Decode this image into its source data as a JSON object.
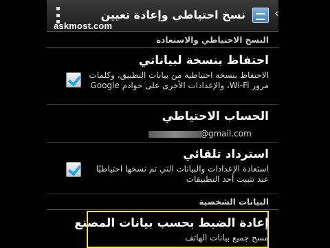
{
  "header": {
    "title": "نسخ احتياطي وإعادة تعيين"
  },
  "watermark": "askmost.com",
  "sections": {
    "backup_restore": "النسخ الاحتياطي والاستعادة",
    "personal_data": "البيانات الشخصية"
  },
  "prefs": {
    "backup_data": {
      "title": "احتفاظ بنسخة لبياناتي",
      "summary": "الاحتفاظ بنسخة احتياطية من بيانات التطبيق، وكلمات مرور Wi-Fi، والإعدادات الأخرى على خوادم Google",
      "checked": true
    },
    "backup_account": {
      "title": "الحساب الاحتياطي",
      "email_domain": "@gmail.com"
    },
    "auto_restore": {
      "title": "استرداد تلقائي",
      "summary": "استعادة الإعدادات والبيانات التي تم نسخها احتياطيًا عند تثبيت أحد التطبيقات",
      "checked": true
    },
    "factory_reset": {
      "title": "إعادة الضبط بحسب بيانات المصنع",
      "summary": "مسح جميع بيانات الهاتف"
    }
  },
  "colors": {
    "highlight": "#f5e63c",
    "check": "#1fa3ee"
  }
}
